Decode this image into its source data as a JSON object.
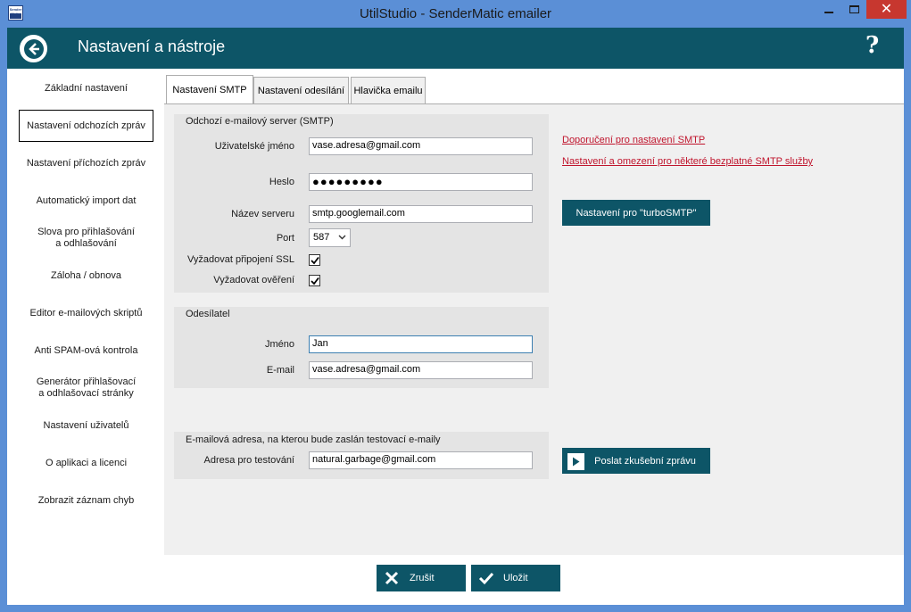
{
  "window": {
    "title": "UtilStudio - SenderMatic emailer",
    "app_icon_text": "Sender Matic"
  },
  "header": {
    "title": "Nastavení a nástroje",
    "help_label": "?"
  },
  "sidebar": {
    "items": [
      {
        "label": "Základní nastavení"
      },
      {
        "label": "Nastavení odchozích zpráv"
      },
      {
        "label": "Nastavení příchozích zpráv"
      },
      {
        "label": "Automatický import dat"
      },
      {
        "label": "Slova pro přihlašování a odhlašování"
      },
      {
        "label": "Záloha / obnova"
      },
      {
        "label": "Editor e-mailových skriptů"
      },
      {
        "label": "Anti SPAM-ová kontrola"
      },
      {
        "label": "Generátor přihlašovací a odhlašovací stránky"
      },
      {
        "label": "Nastavení uživatelů"
      },
      {
        "label": "O aplikaci a licenci"
      },
      {
        "label": "Zobrazit záznam chyb"
      }
    ],
    "active_index": 1
  },
  "tabs": [
    {
      "label": "Nastavení SMTP"
    },
    {
      "label": "Nastavení odesílání"
    },
    {
      "label": "Hlavička emailu"
    }
  ],
  "smtp": {
    "title": "Odchozí e-mailový server (SMTP)",
    "username_label": "Uživatelské jméno",
    "username_value": "vase.adresa@gmail.com",
    "password_label": "Heslo",
    "password_value": "●●●●●●●●●",
    "server_label": "Název serveru",
    "server_value": "smtp.googlemail.com",
    "port_label": "Port",
    "port_value": "587",
    "ssl_label": "Vyžadovat připojení SSL",
    "ssl_checked": true,
    "auth_label": "Vyžadovat ověření",
    "auth_checked": true
  },
  "sender": {
    "title": "Odesílatel",
    "name_label": "Jméno",
    "name_value": "Jan",
    "email_label": "E-mail",
    "email_value": "vase.adresa@gmail.com"
  },
  "test": {
    "title": "E-mailová adresa, na kterou bude zaslán testovací e-maily",
    "address_label": "Adresa pro testování",
    "address_value": "natural.garbage@gmail.com",
    "send_button": "Poslat zkušební zprávu"
  },
  "links": {
    "recommend": "Doporučení pro nastavení SMTP",
    "limits": "Nastavení a omezení pro některé bezplatné SMTP služby"
  },
  "turbo_button": "Nastavení pro \"turboSMTP\"",
  "footer": {
    "cancel_label": "Zrušit",
    "save_label": "Uložit"
  },
  "colors": {
    "header": "#0d5567",
    "titlebar": "#5b8fd6",
    "link": "#c0152d",
    "close": "#c7372f"
  }
}
